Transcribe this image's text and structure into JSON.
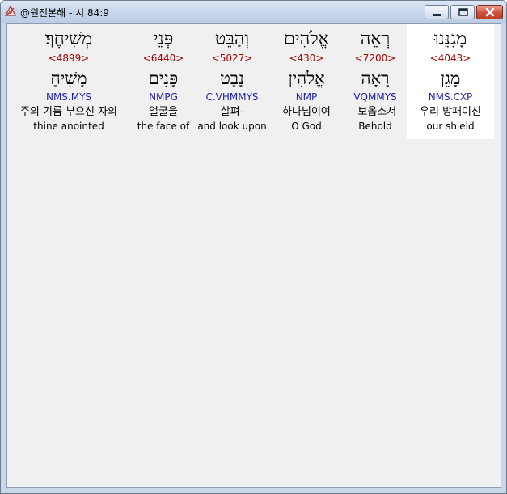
{
  "window": {
    "title": "@원전본해 - 시 84:9",
    "accent": "#c13c24"
  },
  "icons": {
    "app": "app-icon",
    "minimize": "minimize-icon",
    "maximize": "maximize-icon",
    "close": "close-icon"
  },
  "words": [
    {
      "hebrew": "מָגִנֵּנוּ",
      "strong": "<4043>",
      "lemma": "מָגֵן",
      "morph": "NMS.CXP",
      "korean": "우리 방패이신",
      "english": "our shield",
      "selected": true
    },
    {
      "hebrew": "רְאֵה",
      "strong": "<7200>",
      "lemma": "רָאָה",
      "morph": "VQMMYS",
      "korean": "-보옵소서",
      "english": "Behold",
      "selected": false
    },
    {
      "hebrew": "אֱלֹהִים",
      "strong": "<430>",
      "lemma": "אֱלֹהִין",
      "morph": "NMP",
      "korean": "하나님이여",
      "english": "O God",
      "selected": false
    },
    {
      "hebrew": "וְהַבֵּט",
      "strong": "<5027>",
      "lemma": "נָבַט",
      "morph": "C.VHMMYS",
      "korean": "살펴-",
      "english": "and look upon",
      "selected": false
    },
    {
      "hebrew": "פְּנֵי",
      "strong": "<6440>",
      "lemma": "פָּנִים",
      "morph": "NMPG",
      "korean": "얼굴을",
      "english": "the face of",
      "selected": false
    },
    {
      "hebrew": "מְשִׁיחֶךָ׃",
      "strong": "<4899>",
      "lemma": "מָשִׁיחַ",
      "morph": "NMS.MYS",
      "korean": "주의 기름 부으신 자의",
      "english": "thine anointed",
      "selected": false
    }
  ]
}
